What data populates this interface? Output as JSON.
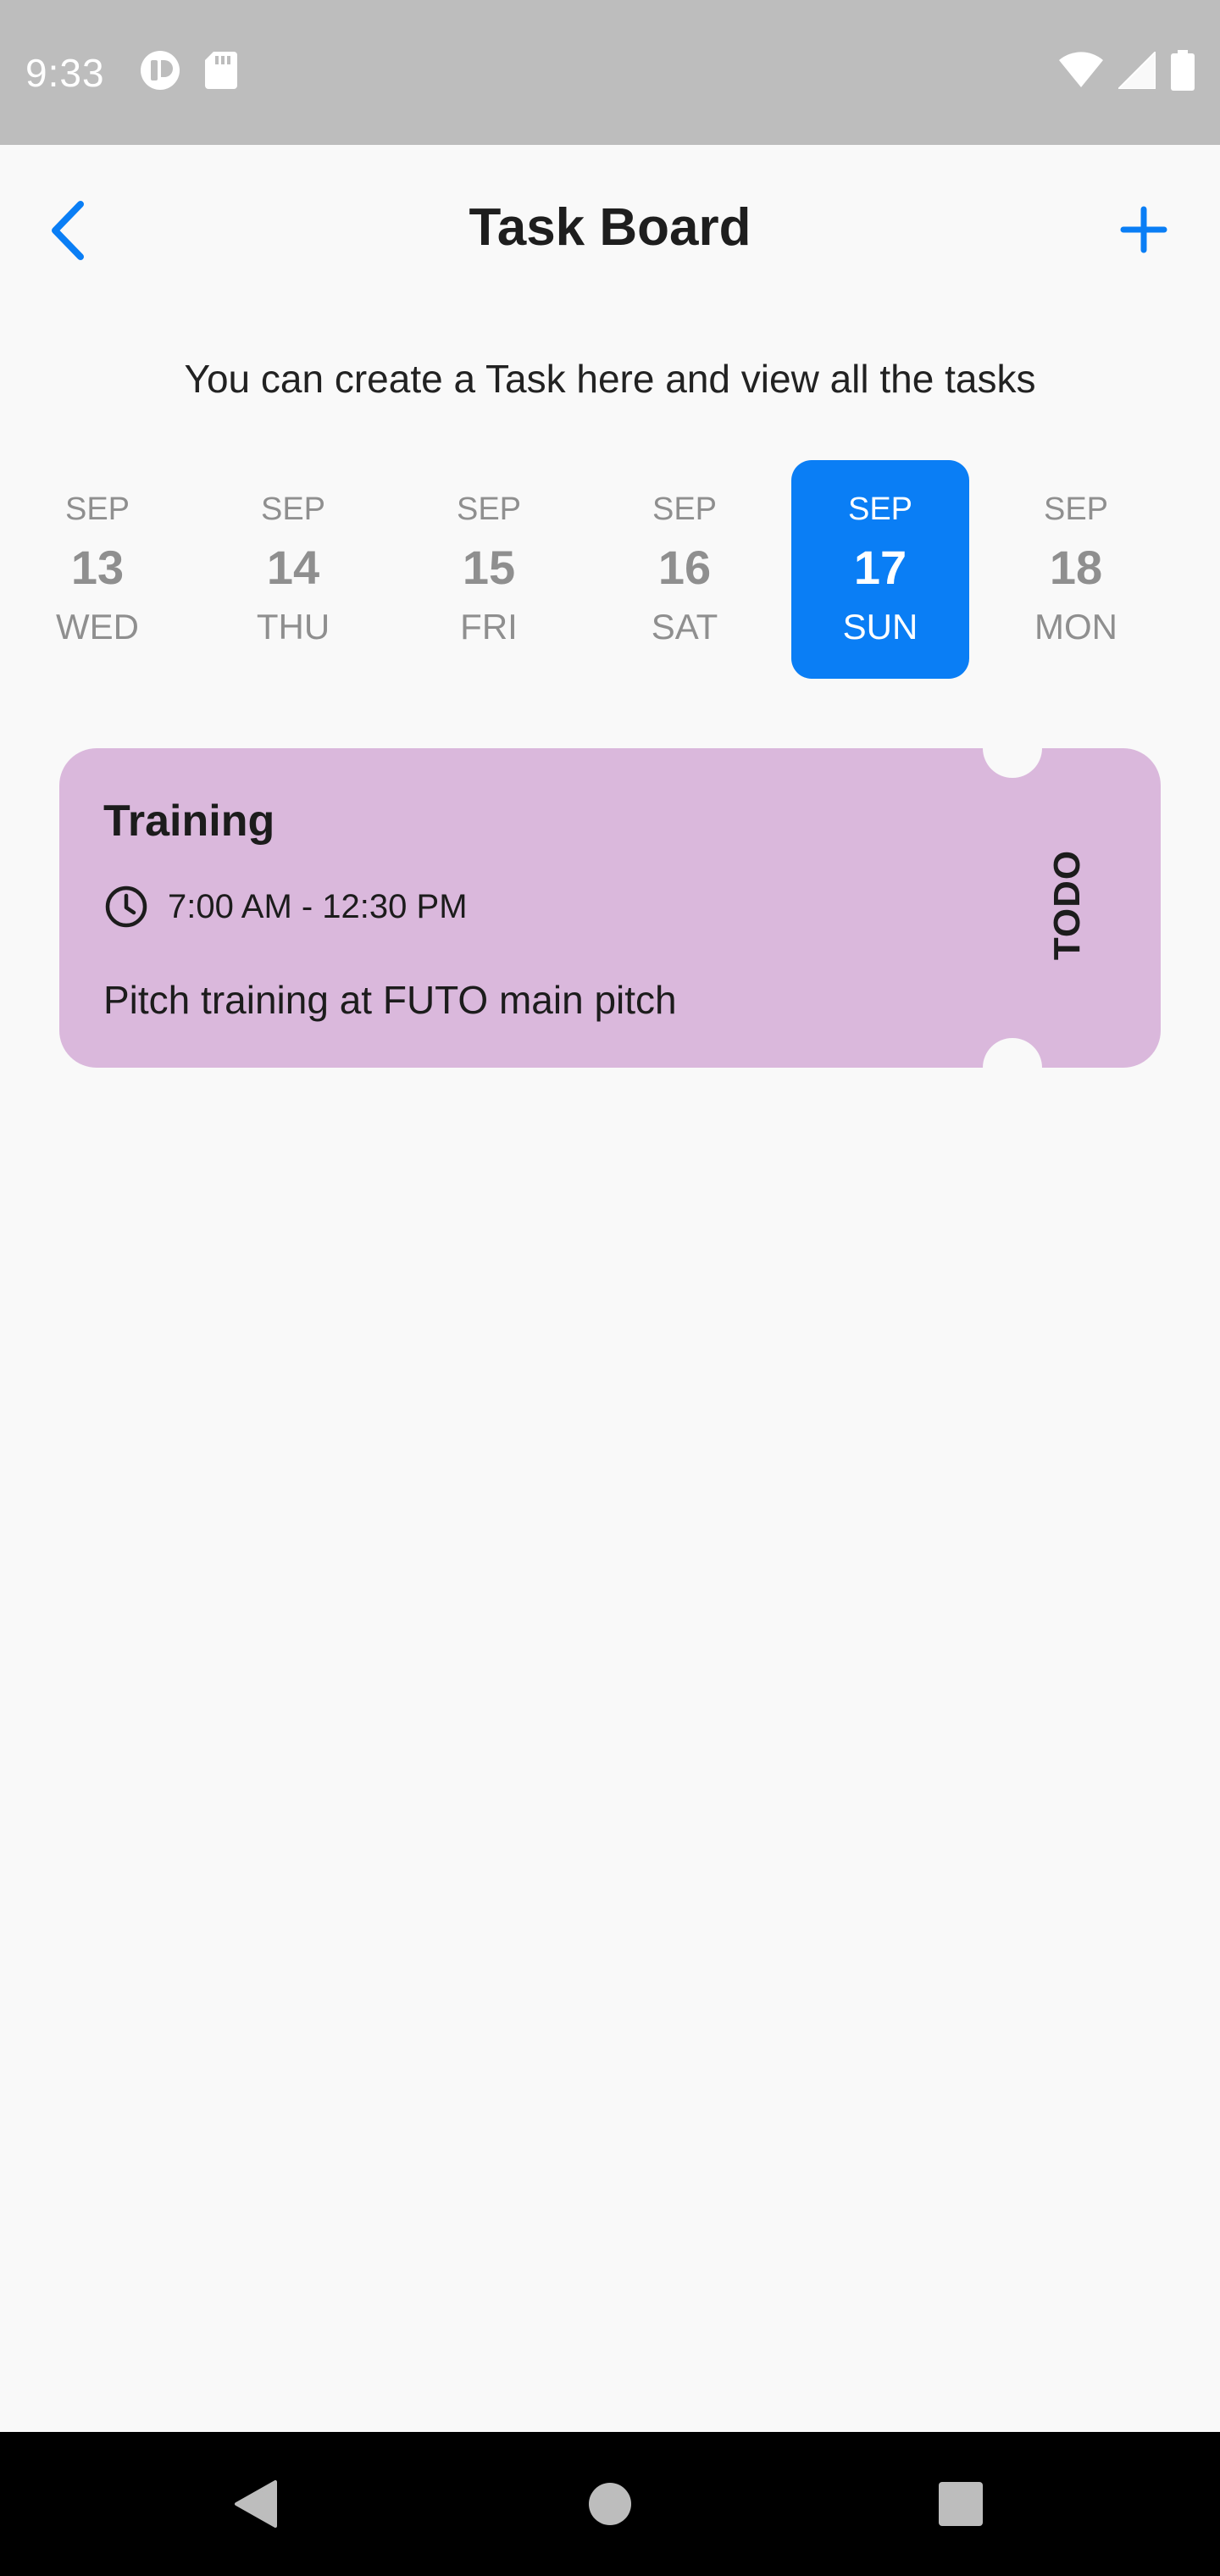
{
  "status_bar": {
    "time": "9:33",
    "icons_left": [
      "app-notification-icon",
      "sd-card-icon"
    ],
    "icons_right": [
      "wifi-icon",
      "signal-icon",
      "battery-icon"
    ]
  },
  "header": {
    "title": "Task Board",
    "back_icon": "chevron-left-icon",
    "add_icon": "plus-icon",
    "accent_color": "#0a7ef5"
  },
  "subtitle": "You can create a Task here and view all the tasks",
  "dates": [
    {
      "month": "SEP",
      "day": "13",
      "weekday": "WED",
      "selected": false
    },
    {
      "month": "SEP",
      "day": "14",
      "weekday": "THU",
      "selected": false
    },
    {
      "month": "SEP",
      "day": "15",
      "weekday": "FRI",
      "selected": false
    },
    {
      "month": "SEP",
      "day": "16",
      "weekday": "SAT",
      "selected": false
    },
    {
      "month": "SEP",
      "day": "17",
      "weekday": "SUN",
      "selected": true
    },
    {
      "month": "SEP",
      "day": "18",
      "weekday": "MON",
      "selected": false
    }
  ],
  "tasks": [
    {
      "title": "Training",
      "time": "7:00 AM - 12:30 PM",
      "description": "Pitch training at FUTO main pitch",
      "status": "TODO",
      "color": "#dab8dc"
    }
  ],
  "nav_bar": {
    "icons": [
      "back-triangle-icon",
      "home-circle-icon",
      "recents-square-icon"
    ]
  }
}
